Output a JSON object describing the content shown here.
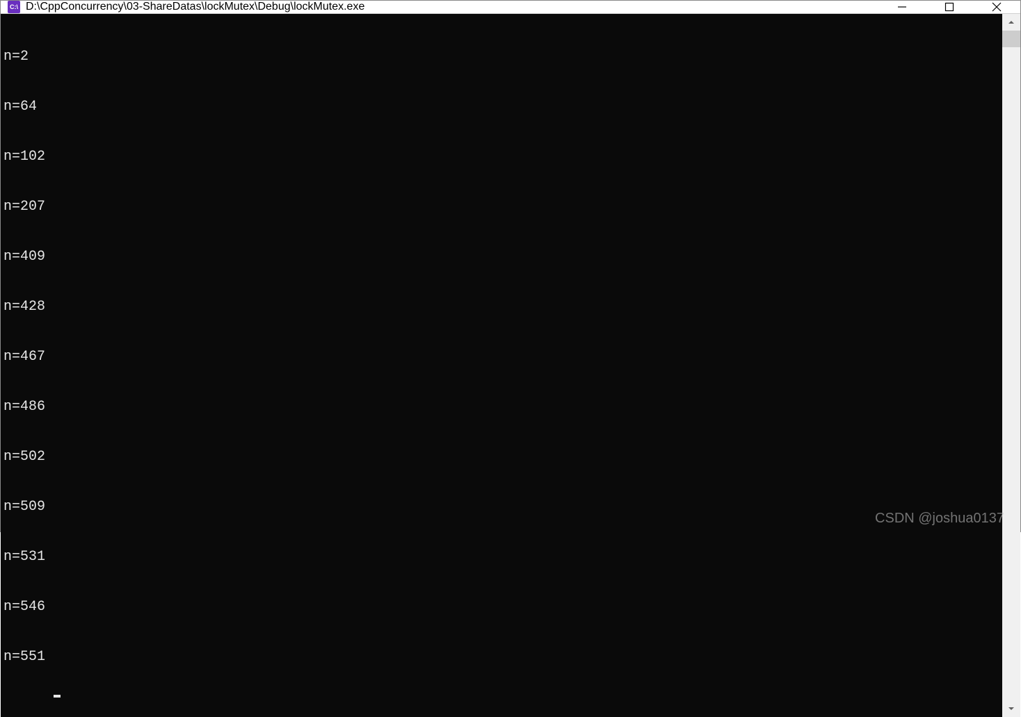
{
  "window": {
    "title": "D:\\CppConcurrency\\03-ShareDatas\\lockMutex\\Debug\\lockMutex.exe",
    "icon_label": "C:\\"
  },
  "console": {
    "lines": [
      "n=2",
      "n=64",
      "n=102",
      "n=207",
      "n=409",
      "n=428",
      "n=467",
      "n=486",
      "n=502",
      "n=509",
      "n=531",
      "n=546",
      "n=551"
    ]
  },
  "watermark": "CSDN @joshua0137"
}
